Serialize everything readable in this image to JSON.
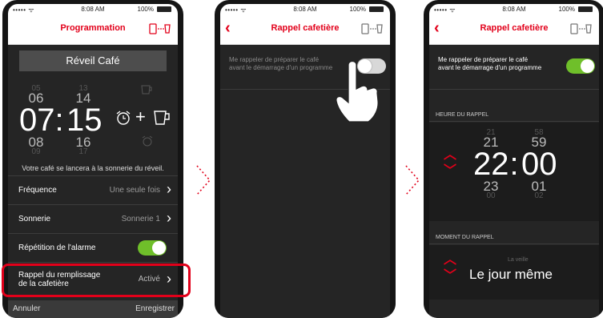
{
  "status": {
    "signal": "••••• ᯤ",
    "time": "8:08 AM",
    "battery": "100%"
  },
  "screen1": {
    "nav_title": "Programmation",
    "banner": "Réveil Café",
    "wheel_hours": [
      "05",
      "06",
      "07",
      "08",
      "09"
    ],
    "wheel_minutes": [
      "13",
      "14",
      "15",
      "16",
      "17"
    ],
    "separator": ":",
    "plus": "+",
    "note": "Votre café se lancera à la sonnerie du réveil.",
    "rows": [
      {
        "label": "Fréquence",
        "value": "Une seule fois"
      },
      {
        "label": "Sonnerie",
        "value": "Sonnerie 1"
      },
      {
        "label": "Répétition de l'alarme",
        "toggle": true
      },
      {
        "label": "Rappel du remplissage de la cafetière",
        "value": "Activé"
      }
    ],
    "row4_label_line1": "Rappel du remplissage",
    "row4_label_line2": "de la cafetière",
    "cancel": "Annuler",
    "save": "Enregistrer"
  },
  "screen2": {
    "nav_title": "Rappel cafetière",
    "option_line1": "Me rappeler de préparer le café",
    "option_line2": "avant le démarrage d'un programme",
    "toggle_on": false
  },
  "screen3": {
    "nav_title": "Rappel cafetière",
    "option_line1": "Me rappeler de préparer le café",
    "option_line2": "avant le démarrage d'un programme",
    "toggle_on": true,
    "section_time": "HEURE DU RAPPEL",
    "hours": [
      "21",
      "21",
      "22",
      "23",
      "00"
    ],
    "minutes": [
      "58",
      "59",
      "00",
      "01",
      "02"
    ],
    "separator": ":",
    "section_moment": "MOMENT DU RAPPEL",
    "moment_prev": "La veille",
    "moment_current": "Le jour même"
  },
  "colors": {
    "accent": "#e2001a",
    "toggle_on": "#6fbf2a",
    "background": "#252525"
  }
}
